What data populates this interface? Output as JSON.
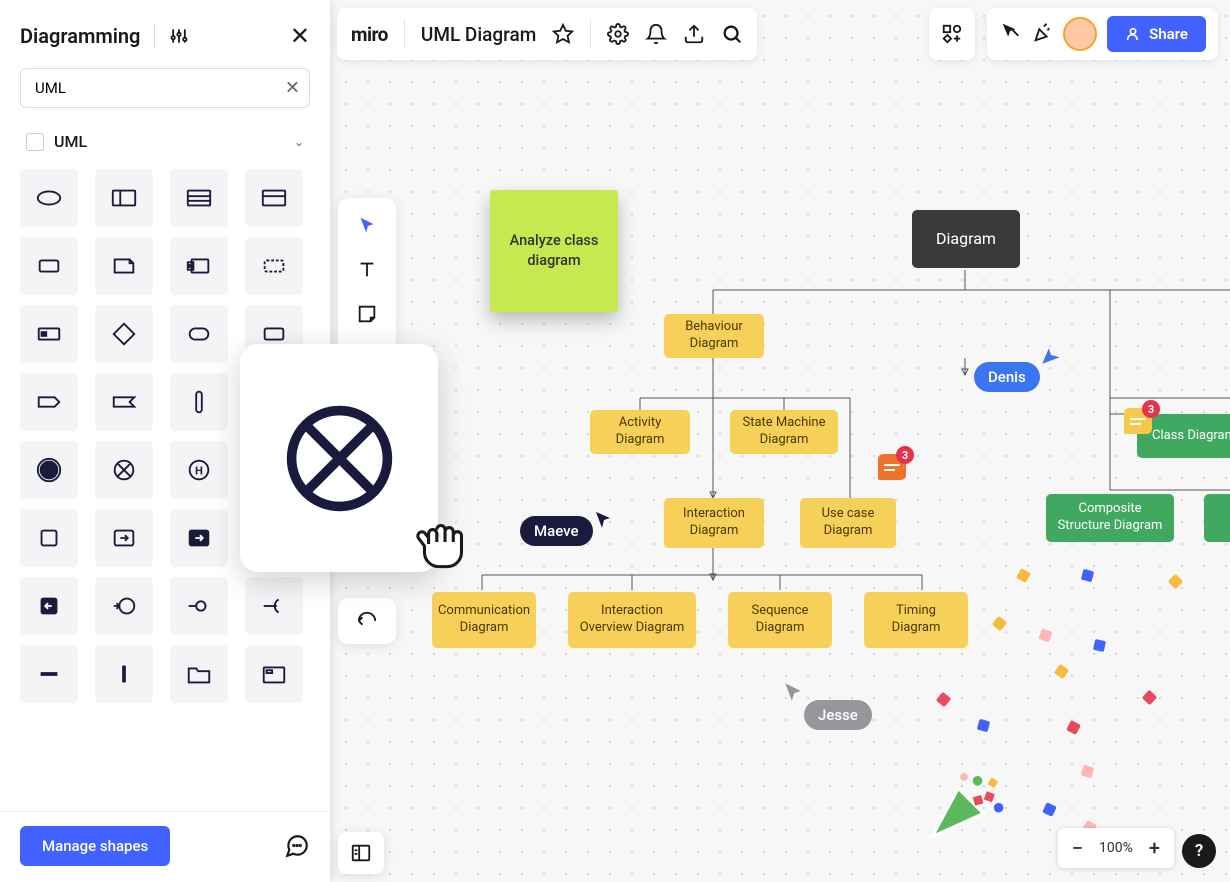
{
  "sidebar": {
    "title": "Diagramming",
    "search_value": "UML",
    "category": "UML",
    "manage_label": "Manage shapes"
  },
  "topbar": {
    "logo": "miro",
    "board_title": "UML Diagram"
  },
  "share": {
    "label": "Share"
  },
  "sticky": {
    "text": "Analyze class diagram"
  },
  "users": {
    "maeve": "Maeve",
    "denis": "Denis",
    "jesse": "Jesse"
  },
  "nodes": {
    "root": "Diagram",
    "behaviour": "Behaviour Diagram",
    "activity": "Activity Diagram",
    "state_machine": "State Machine Diagram",
    "interaction": "Interaction Diagram",
    "use_case": "Use case Diagram",
    "communication": "Communication Diagram",
    "interaction_overview": "Interaction Overview Diagram",
    "sequence": "Sequence Diagram",
    "timing": "Timing Diagram",
    "class": "Class Diagram",
    "composite": "Composite Structure Diagram"
  },
  "comments": {
    "count1": "3",
    "count2": "3"
  },
  "zoom": {
    "level": "100%"
  }
}
